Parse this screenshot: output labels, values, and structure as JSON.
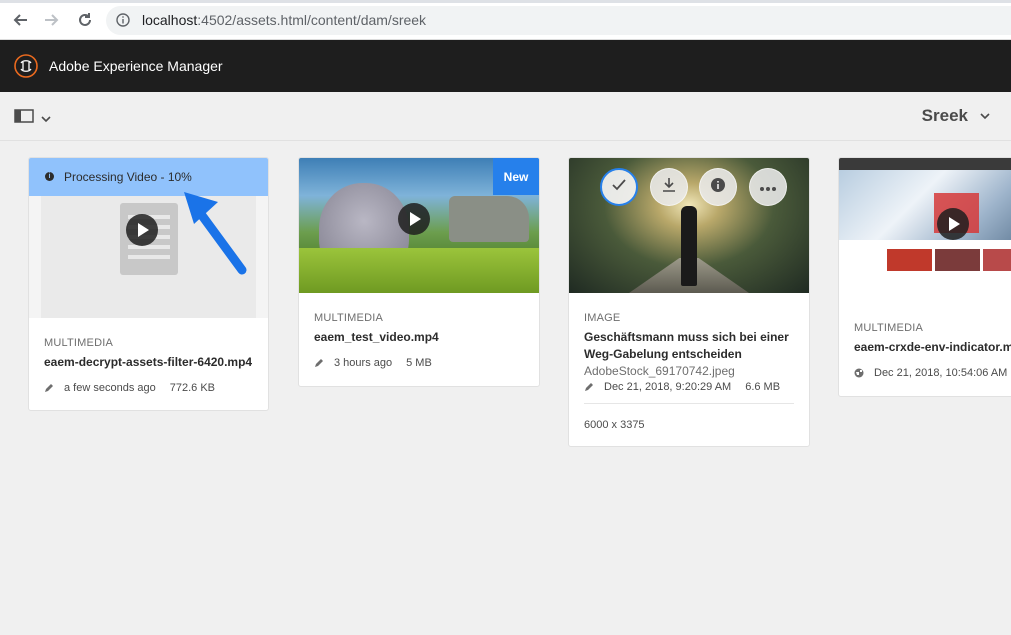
{
  "browser": {
    "url_host": "localhost",
    "url_rest": ":4502/assets.html/content/dam/sreek"
  },
  "header": {
    "title": "Adobe Experience Manager"
  },
  "action_bar": {
    "folder_title": "Sreek"
  },
  "cards": [
    {
      "processing_text": "Processing Video - 10%",
      "type": "MULTIMEDIA",
      "name": "eaem-decrypt-assets-filter-6420.mp4",
      "modified": "a few seconds ago",
      "size": "772.6 KB"
    },
    {
      "badge": "New",
      "type": "MULTIMEDIA",
      "name": "eaem_test_video.mp4",
      "modified": "3 hours ago",
      "size": "5 MB"
    },
    {
      "type": "IMAGE",
      "title_line1": "Geschäftsmann muss sich bei einer",
      "title_line2": "Weg-Gabelung entscheiden",
      "name": "AdobeStock_69170742.jpeg",
      "modified": "Dec 21, 2018, 9:20:29 AM",
      "size": "6.6 MB",
      "dimensions": "6000 x 3375"
    },
    {
      "type": "MULTIMEDIA",
      "name": "eaem-crxde-env-indicator.mp",
      "modified": "Dec 21, 2018, 10:54:06 AM"
    }
  ],
  "colors": {
    "processing_bar": "#90c2fc",
    "new_badge": "#2680eb",
    "header_bg": "#1e1e1e",
    "arrow": "#1a73e8"
  },
  "icons": [
    "back-icon",
    "forward-icon",
    "reload-icon",
    "info-icon",
    "aem-logo-icon",
    "rail-toggle-icon",
    "chevron-down-icon",
    "play-icon",
    "edit-icon",
    "checkmark-icon",
    "download-icon",
    "more-icon",
    "globe-icon"
  ]
}
